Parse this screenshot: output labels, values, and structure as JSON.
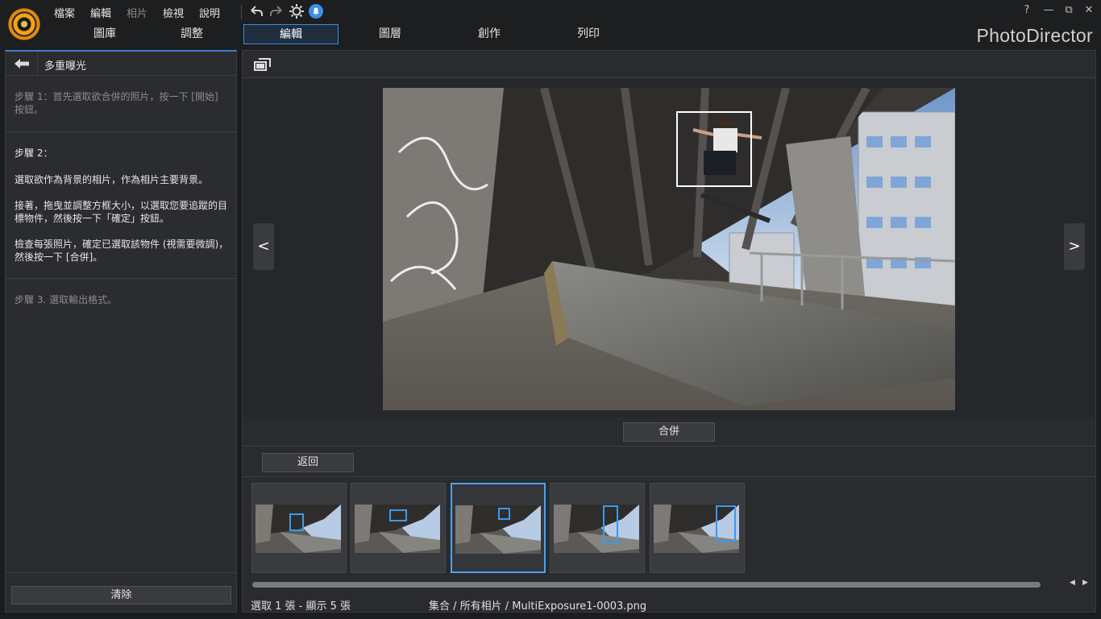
{
  "menu": {
    "file": "檔案",
    "edit": "編輯",
    "photo": "相片",
    "view": "檢視",
    "help": "說明"
  },
  "icons": {
    "undo": "undo-icon",
    "redo": "redo-icon",
    "settings": "gear-icon",
    "notification": "notification-icon"
  },
  "tabs": [
    {
      "label": "圖庫"
    },
    {
      "label": "調整"
    },
    {
      "label": "編輯",
      "active": true
    },
    {
      "label": "圖層"
    },
    {
      "label": "創作"
    },
    {
      "label": "列印"
    }
  ],
  "brand": "PhotoDirector",
  "window": {
    "help": "?",
    "minimize": "—",
    "restore": "⧉",
    "close": "✕"
  },
  "panel": {
    "title": "多重曝光",
    "step1": "步驟 1：首先選取欲合併的照片，按一下 [開始] 按鈕。",
    "step2_title": "步驟 2：",
    "step2_p1": "選取欲作為背景的相片，作為相片主要背景。",
    "step2_p2": "接著，拖曳並調整方框大小，以選取您要追蹤的目標物件，然後按一下「確定」按鈕。",
    "step2_p3": "檢查每張照片，確定已選取該物件 (視需要微調)，然後按一下 [合併]。",
    "step3": "步驟 3. 選取輸出格式。",
    "clear_button": "清除"
  },
  "viewer": {
    "prev": "<",
    "next": ">",
    "merge_button": "合併",
    "back_button": "返回"
  },
  "thumbnails": [
    {
      "selected": false
    },
    {
      "selected": false
    },
    {
      "selected": true
    },
    {
      "selected": false
    },
    {
      "selected": false
    }
  ],
  "status": {
    "selection": "選取 1 張 - 顯示 5 張",
    "path": "集合 / 所有相片 / MultiExposure1-0003.png"
  },
  "colors": {
    "accent": "#3d8ad8",
    "selection_border": "#4aa3f0",
    "panel_bg": "#2b2c2f",
    "app_bg": "#1b1c1e"
  }
}
